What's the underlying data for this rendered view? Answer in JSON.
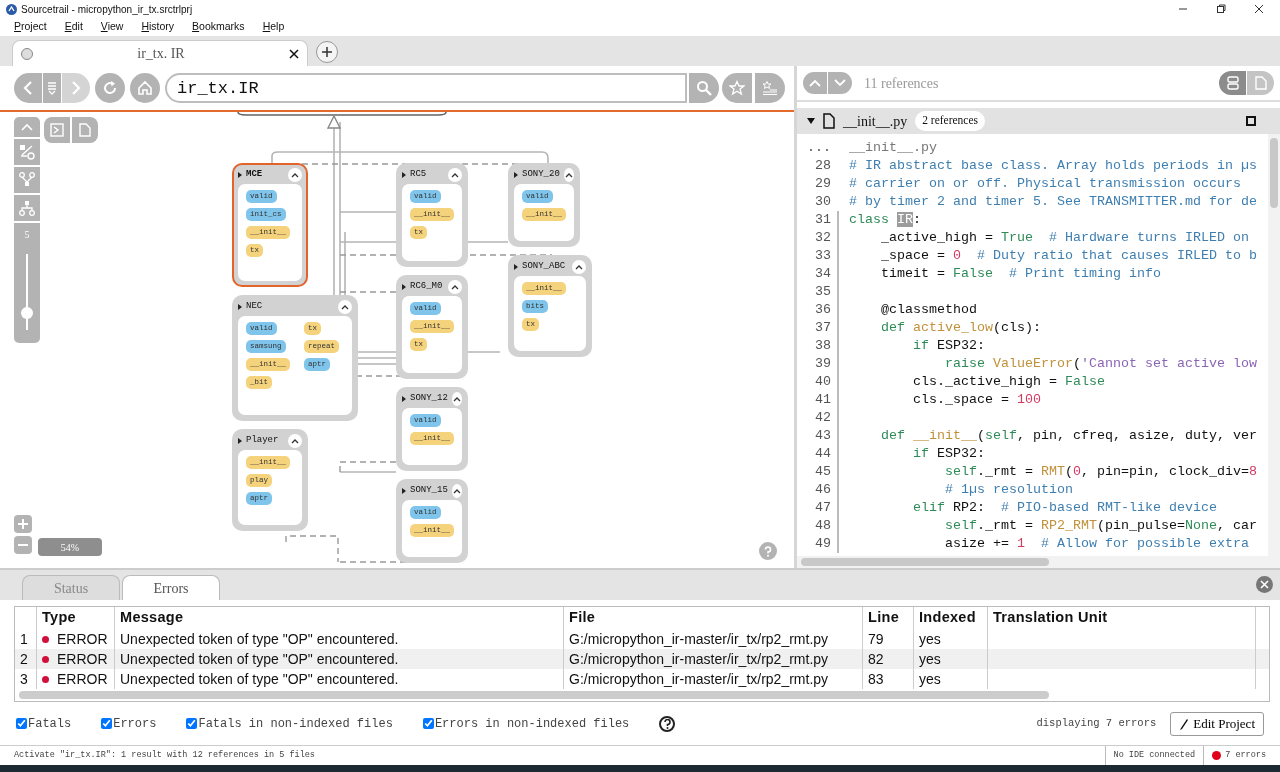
{
  "window": {
    "title": "Sourcetrail - micropython_ir_tx.srctrlprj"
  },
  "menu": [
    "Project",
    "Edit",
    "View",
    "History",
    "Bookmarks",
    "Help"
  ],
  "tabs": [
    {
      "label": "ir_tx. IR",
      "selected": true
    }
  ],
  "search": {
    "value": "ir_tx.IR"
  },
  "graph": {
    "depth_label": "5",
    "depth": {
      "level": 0.22
    },
    "zoom": "54%",
    "nodes": [
      {
        "name": "MCE",
        "selected": true,
        "members": [
          {
            "name": "valid",
            "color": "#7fc4ea"
          },
          {
            "name": "init_cs",
            "color": "#7fc4ea"
          },
          {
            "name": "__init__",
            "color": "#f5d27c"
          },
          {
            "name": "tx",
            "color": "#f5d27c"
          }
        ]
      },
      {
        "name": "RC5",
        "selected": false,
        "members": [
          {
            "name": "valid",
            "color": "#7fc4ea"
          },
          {
            "name": "__init__",
            "color": "#f5d27c"
          },
          {
            "name": "tx",
            "color": "#f5d27c"
          }
        ]
      },
      {
        "name": "SONY_20",
        "selected": false,
        "members": [
          {
            "name": "valid",
            "color": "#7fc4ea"
          },
          {
            "name": "__init__",
            "color": "#f5d27c"
          }
        ]
      },
      {
        "name": "RC6_M0",
        "selected": false,
        "members": [
          {
            "name": "valid",
            "color": "#7fc4ea"
          },
          {
            "name": "__init__",
            "color": "#f5d27c"
          },
          {
            "name": "tx",
            "color": "#f5d27c"
          }
        ]
      },
      {
        "name": "SONY_ABC",
        "selected": false,
        "members": [
          {
            "name": "__init__",
            "color": "#f5d27c"
          },
          {
            "name": "bits",
            "color": "#7fc4ea"
          },
          {
            "name": "tx",
            "color": "#f5d27c"
          }
        ]
      },
      {
        "name": "NEC",
        "selected": false,
        "members": [
          {
            "name": "valid",
            "color": "#7fc4ea"
          },
          {
            "name": "samsung",
            "color": "#7fc4ea"
          },
          {
            "name": "__init__",
            "color": "#f5d27c"
          },
          {
            "name": "_bit",
            "color": "#f5d27c"
          },
          {
            "name": "tx",
            "color": "#f5d27c"
          },
          {
            "name": "repeat",
            "color": "#f5d27c"
          },
          {
            "name": "aptr",
            "color": "#7fc4ea"
          }
        ]
      },
      {
        "name": "SONY_12",
        "selected": false,
        "members": [
          {
            "name": "valid",
            "color": "#7fc4ea"
          },
          {
            "name": "__init__",
            "color": "#f5d27c"
          }
        ]
      },
      {
        "name": "Player",
        "selected": false,
        "members": [
          {
            "name": "__init__",
            "color": "#f5d27c"
          },
          {
            "name": "play",
            "color": "#f5d27c"
          },
          {
            "name": "aptr",
            "color": "#7fc4ea"
          }
        ]
      },
      {
        "name": "SONY_15",
        "selected": false,
        "members": [
          {
            "name": "valid",
            "color": "#7fc4ea"
          },
          {
            "name": "__init__",
            "color": "#f5d27c"
          }
        ]
      }
    ]
  },
  "code": {
    "references": "11 references",
    "view_modes": [
      {
        "kind": "list",
        "selected": true
      },
      {
        "kind": "file",
        "selected": false
      }
    ],
    "file": {
      "name": "__init__.py",
      "badge": "2 references",
      "expanded": true
    },
    "path_line": {
      "marker": "...",
      "text": "__init__.py"
    },
    "lines": [
      {
        "number": "28",
        "in_scope": false,
        "tokens": [
          {
            "kind": "comment",
            "text": "# IR abstract base class. Array holds periods in µs"
          }
        ]
      },
      {
        "number": "29",
        "in_scope": false,
        "tokens": [
          {
            "kind": "comment",
            "text": "# carrier on or off. Physical transmission occurs"
          }
        ]
      },
      {
        "number": "30",
        "in_scope": false,
        "tokens": [
          {
            "kind": "comment",
            "text": "# by timer 2 and timer 5. See TRANSMITTER.md for de"
          }
        ]
      },
      {
        "number": "31",
        "in_scope": true,
        "tokens": [
          {
            "kind": "keyword",
            "text": "class "
          },
          {
            "kind": "highlight",
            "text": "IR"
          },
          {
            "kind": "plain",
            "text": ":"
          }
        ]
      },
      {
        "number": "32",
        "in_scope": true,
        "tokens": [
          {
            "kind": "plain",
            "text": "    _active_high = "
          },
          {
            "kind": "keyword",
            "text": "True  "
          },
          {
            "kind": "comment",
            "text": "# Hardware turns IRLED on"
          }
        ]
      },
      {
        "number": "33",
        "in_scope": true,
        "tokens": [
          {
            "kind": "plain",
            "text": "    _space = "
          },
          {
            "kind": "number",
            "text": "0  "
          },
          {
            "kind": "comment",
            "text": "# Duty ratio that causes IRLED to b"
          }
        ]
      },
      {
        "number": "34",
        "in_scope": true,
        "tokens": [
          {
            "kind": "plain",
            "text": "    timeit = "
          },
          {
            "kind": "keyword",
            "text": "False  "
          },
          {
            "kind": "comment",
            "text": "# Print timing info"
          }
        ]
      },
      {
        "number": "35",
        "in_scope": true
      },
      {
        "number": "36",
        "in_scope": true,
        "tokens": [
          {
            "kind": "plain",
            "text": "    @classmethod"
          }
        ]
      },
      {
        "number": "37",
        "in_scope": true,
        "tokens": [
          {
            "kind": "keyword",
            "text": "    def "
          },
          {
            "kind": "func",
            "text": "active_low"
          },
          {
            "kind": "plain",
            "text": "(cls):"
          }
        ]
      },
      {
        "number": "38",
        "in_scope": true,
        "tokens": [
          {
            "kind": "keyword",
            "text": "        if"
          },
          {
            "kind": "plain",
            "text": " ESP32:"
          }
        ]
      },
      {
        "number": "39",
        "in_scope": true,
        "tokens": [
          {
            "kind": "keyword",
            "text": "            raise "
          },
          {
            "kind": "func",
            "text": "ValueError"
          },
          {
            "kind": "plain",
            "text": "("
          },
          {
            "kind": "string",
            "text": "'Cannot set active low"
          }
        ]
      },
      {
        "number": "40",
        "in_scope": true,
        "tokens": [
          {
            "kind": "plain",
            "text": "        cls._active_high = "
          },
          {
            "kind": "keyword",
            "text": "False"
          }
        ]
      },
      {
        "number": "41",
        "in_scope": true,
        "tokens": [
          {
            "kind": "plain",
            "text": "        cls._space = "
          },
          {
            "kind": "number",
            "text": "100"
          }
        ]
      },
      {
        "number": "42",
        "in_scope": true
      },
      {
        "number": "43",
        "in_scope": true,
        "tokens": [
          {
            "kind": "keyword",
            "text": "    def "
          },
          {
            "kind": "func",
            "text": "__init__"
          },
          {
            "kind": "plain",
            "text": "("
          },
          {
            "kind": "keyword",
            "text": "self"
          },
          {
            "kind": "plain",
            "text": ", pin, cfreq, asize, duty, ver"
          }
        ]
      },
      {
        "number": "44",
        "in_scope": true,
        "tokens": [
          {
            "kind": "keyword",
            "text": "        if"
          },
          {
            "kind": "plain",
            "text": " ESP32:"
          }
        ]
      },
      {
        "number": "45",
        "in_scope": true,
        "tokens": [
          {
            "kind": "keyword",
            "text": "            self"
          },
          {
            "kind": "plain",
            "text": "._rmt = "
          },
          {
            "kind": "func",
            "text": "RMT"
          },
          {
            "kind": "plain",
            "text": "("
          },
          {
            "kind": "number",
            "text": "0"
          },
          {
            "kind": "plain",
            "text": ", pin=pin, clock_div="
          },
          {
            "kind": "number",
            "text": "8"
          }
        ]
      },
      {
        "number": "46",
        "in_scope": true,
        "tokens": [
          {
            "kind": "comment",
            "text": "            # 1µs resolution"
          }
        ]
      },
      {
        "number": "47",
        "in_scope": true,
        "tokens": [
          {
            "kind": "keyword",
            "text": "        elif"
          },
          {
            "kind": "plain",
            "text": " RP2:  "
          },
          {
            "kind": "comment",
            "text": "# PIO-based RMT-like device"
          }
        ]
      },
      {
        "number": "48",
        "in_scope": true,
        "tokens": [
          {
            "kind": "keyword",
            "text": "            self"
          },
          {
            "kind": "plain",
            "text": "._rmt = "
          },
          {
            "kind": "func",
            "text": "RP2_RMT"
          },
          {
            "kind": "plain",
            "text": "(pin_pulse="
          },
          {
            "kind": "keyword",
            "text": "None"
          },
          {
            "kind": "plain",
            "text": ", car"
          }
        ]
      },
      {
        "number": "49",
        "in_scope": true,
        "tokens": [
          {
            "kind": "plain",
            "text": "            asize += "
          },
          {
            "kind": "number",
            "text": "1  "
          },
          {
            "kind": "comment",
            "text": "# Allow for possible extra"
          }
        ]
      }
    ]
  },
  "bottom_tabs": [
    {
      "label": "Status",
      "selected": false
    },
    {
      "label": "Errors",
      "selected": true
    }
  ],
  "errors": {
    "columns": [
      "Type",
      "Message",
      "File",
      "Line",
      "Indexed",
      "Translation Unit"
    ],
    "rows": [
      {
        "index": "1",
        "type": "ERROR",
        "message": "Unexpected token of type \"OP\" encountered.",
        "file": "G:/micropython_ir-master/ir_tx/rp2_rmt.py",
        "line": "79",
        "indexed": "yes"
      },
      {
        "index": "2",
        "type": "ERROR",
        "message": "Unexpected token of type \"OP\" encountered.",
        "file": "G:/micropython_ir-master/ir_tx/rp2_rmt.py",
        "line": "82",
        "indexed": "yes"
      },
      {
        "index": "3",
        "type": "ERROR",
        "message": "Unexpected token of type \"OP\" encountered.",
        "file": "G:/micropython_ir-master/ir_tx/rp2_rmt.py",
        "line": "83",
        "indexed": "yes"
      }
    ]
  },
  "filters": [
    {
      "label": "Fatals",
      "checked": true
    },
    {
      "label": "Errors",
      "checked": true
    },
    {
      "label": "Fatals in non-indexed files",
      "checked": true
    },
    {
      "label": "Errors in non-indexed files",
      "checked": true
    }
  ],
  "error_count": "displaying 7 errors",
  "edit_button": "Edit Project",
  "status_bar": {
    "message": "Activate \"ir_tx.IR\": 1 result with 12 references in 5 files",
    "ide": "No IDE connected",
    "errors": "7 errors"
  }
}
